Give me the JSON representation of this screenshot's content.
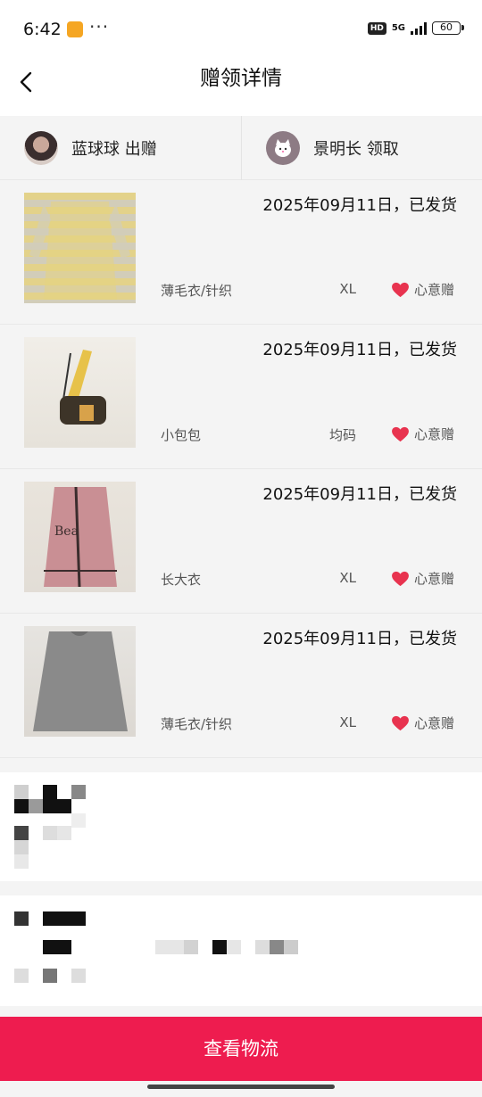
{
  "status_bar": {
    "time": "6:42",
    "dots": "···",
    "hd": "HD",
    "network": "5G",
    "battery": "60"
  },
  "nav": {
    "title": "赠领详情"
  },
  "giver": {
    "text": "蓝球球 出赠"
  },
  "receiver": {
    "text": "景明长 领取"
  },
  "items": [
    {
      "date": "2025年09月11日，已发货",
      "category": "薄毛衣/针织",
      "size": "XL",
      "tag": "心意赠"
    },
    {
      "date": "2025年09月11日，已发货",
      "category": "小包包",
      "size": "均码",
      "tag": "心意赠"
    },
    {
      "date": "2025年09月11日，已发货",
      "category": "长大衣",
      "size": "XL",
      "tag": "心意赠"
    },
    {
      "date": "2025年09月11日，已发货",
      "category": "薄毛衣/针织",
      "size": "XL",
      "tag": "心意赠"
    }
  ],
  "button": {
    "label": "查看物流"
  },
  "colors": {
    "accent": "#ee1c4f",
    "heart": "#e8334f"
  }
}
